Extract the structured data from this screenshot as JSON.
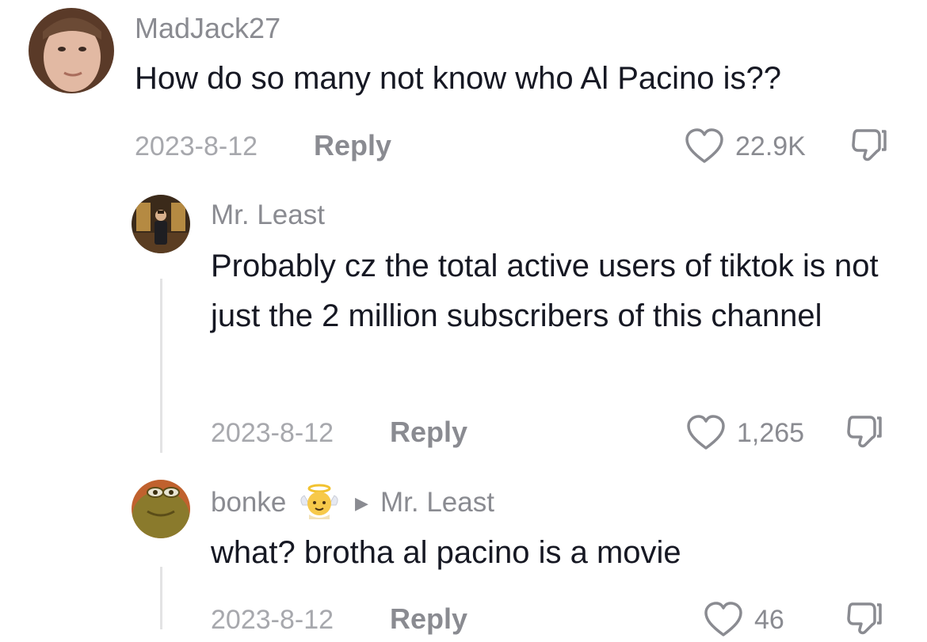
{
  "comments": [
    {
      "username": "MadJack27",
      "text": "How do so many not know who Al Pacino is??",
      "date": "2023-8-12",
      "reply_label": "Reply",
      "likes": "22.9K"
    },
    {
      "username": "Mr. Least",
      "text": "Probably cz the total active users of tiktok is not just the 2 million subscribers of this channel",
      "date": "2023-8-12",
      "reply_label": "Reply",
      "likes": "1,265"
    },
    {
      "username": "bonke",
      "badge_icon": "angel-emoji-icon",
      "reply_to": "Mr. Least",
      "text": "what? brotha al pacino is a movie",
      "date": "2023-8-12",
      "reply_label": "Reply",
      "likes": "46"
    }
  ],
  "icons": {
    "like": "heart-outline-icon",
    "dislike": "thumbs-down-icon",
    "reply_arrow": "triangle-right-icon"
  },
  "colors": {
    "text": "#161823",
    "secondary": "#8a8b91",
    "date": "#a7a8ad"
  }
}
